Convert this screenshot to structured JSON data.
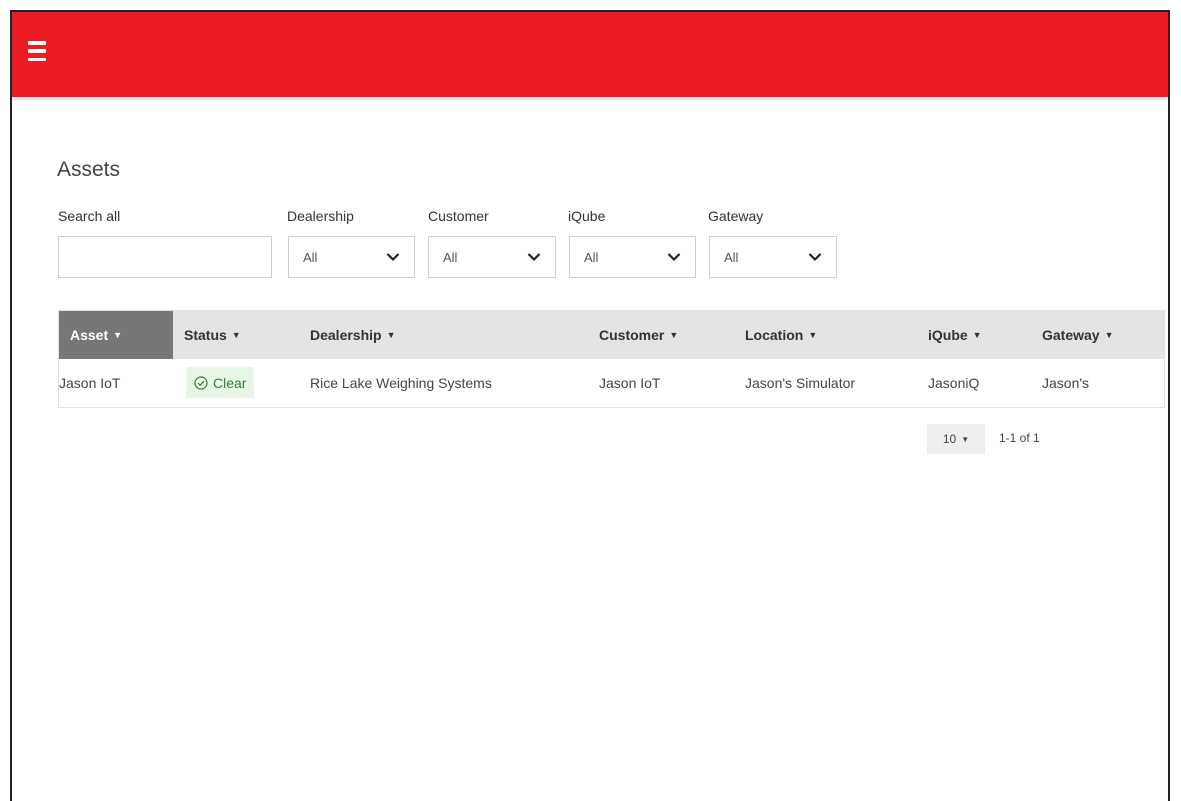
{
  "header": {
    "menu_icon": "hamburger-menu-icon",
    "bg_color": "#ed1c24"
  },
  "page": {
    "title": "Assets"
  },
  "filters": {
    "search_label": "Search all",
    "search_value": "",
    "dealership": {
      "label": "Dealership",
      "value": "All"
    },
    "customer": {
      "label": "Customer",
      "value": "All"
    },
    "iqube": {
      "label": "iQube",
      "value": "All"
    },
    "gateway": {
      "label": "Gateway",
      "value": "All"
    }
  },
  "table": {
    "columns": [
      "Asset",
      "Status",
      "Dealership",
      "Customer",
      "Location",
      "iQube",
      "Gateway"
    ],
    "rows": [
      {
        "asset": "Jason IoT",
        "status": "Clear",
        "status_icon": "check-circle-icon",
        "dealership": "Rice Lake Weighing Systems",
        "customer": "Jason IoT",
        "location": "Jason's Simulator",
        "iqube": "JasoniQ",
        "gateway": "Jason's"
      }
    ]
  },
  "pagination": {
    "page_size": "10",
    "range": "1-1 of 1"
  }
}
